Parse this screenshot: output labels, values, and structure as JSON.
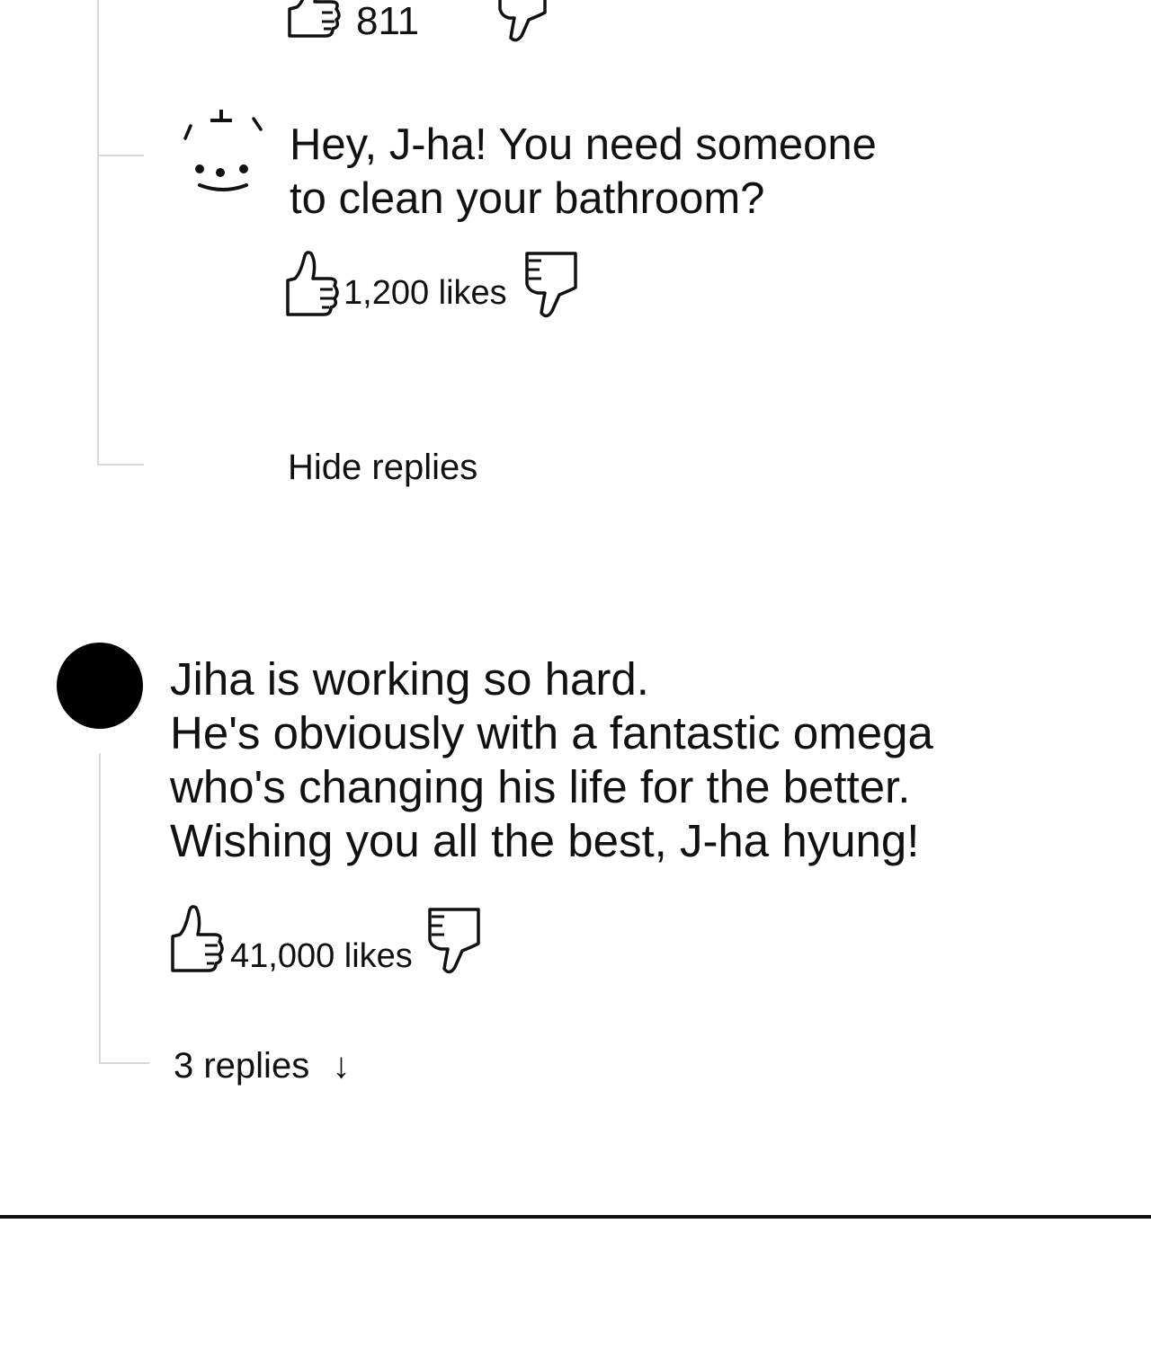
{
  "top_reply": {
    "likes": "811"
  },
  "reply": {
    "text": "Hey, J-ha! You need someone\nto clean your bathroom?",
    "likes": "1,200 likes",
    "hide_replies_label": "Hide replies"
  },
  "comment": {
    "text": "Jiha is working so hard.\nHe's obviously with a fantastic omega\nwho's changing his life for the better.\nWishing you all the best, J-ha hyung!",
    "likes": "41,000 likes",
    "replies_label": "3 replies",
    "replies_arrow": "↓"
  },
  "icons": {
    "like": "thumbs-up-icon",
    "dislike": "thumbs-down-icon",
    "avatar_reply": "smiley-avatar",
    "avatar_comment": "black-circle-avatar"
  },
  "colors": {
    "text": "#111111",
    "thread_line": "#d9d9d9",
    "avatar": "#000000"
  }
}
